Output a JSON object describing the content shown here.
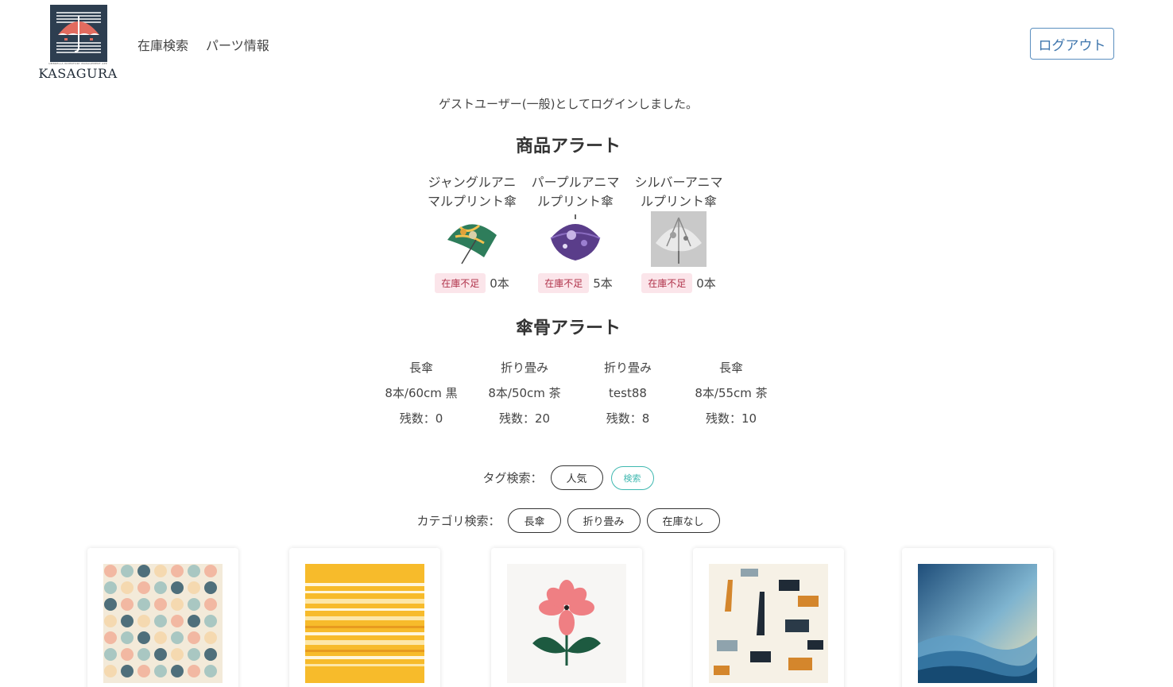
{
  "header": {
    "logo_text": "KASAGURA",
    "logo_tagline": "UMBRELLA INVENTORY MANAGEMENT APP",
    "nav": [
      "在庫検索",
      "パーツ情報"
    ],
    "logout_label": "ログアウト"
  },
  "login_message": "ゲストユーザー(一般)としてログインしました。",
  "product_alerts": {
    "title": "商品アラート",
    "items": [
      {
        "name": "ジャングルアニマルプリント傘",
        "badge": "在庫不足",
        "count": "0本"
      },
      {
        "name": "パープルアニマルプリント傘",
        "badge": "在庫不足",
        "count": "5本"
      },
      {
        "name": "シルバーアニマルプリント傘",
        "badge": "在庫不足",
        "count": "0本"
      }
    ]
  },
  "rib_alerts": {
    "title": "傘骨アラート",
    "items": [
      {
        "type": "長傘",
        "spec": "8本/60cm 黒",
        "remaining": "残数：0"
      },
      {
        "type": "折り畳み",
        "spec": "8本/50cm 茶",
        "remaining": "残数：20"
      },
      {
        "type": "折り畳み",
        "spec": "test88",
        "remaining": "残数：8"
      },
      {
        "type": "長傘",
        "spec": "8本/55cm 茶",
        "remaining": "残数：10"
      }
    ]
  },
  "tag_search": {
    "label": "タグ検索：",
    "tags": [
      "人気"
    ],
    "search_label": "検索"
  },
  "category_search": {
    "label": "カテゴリ検索：",
    "categories": [
      "長傘",
      "折り畳み",
      "在庫なし"
    ]
  },
  "pattern_cards": [
    {
      "pattern": "polka-dots-pastel"
    },
    {
      "pattern": "yellow-stripes"
    },
    {
      "pattern": "pink-flower"
    },
    {
      "pattern": "safari-animals"
    },
    {
      "pattern": "blue-waves"
    }
  ],
  "colors": {
    "accent_blue": "#3f76ad",
    "badge_bg": "#fbe5ea",
    "badge_text": "#b0324a",
    "search_teal": "#3fb8b0"
  }
}
